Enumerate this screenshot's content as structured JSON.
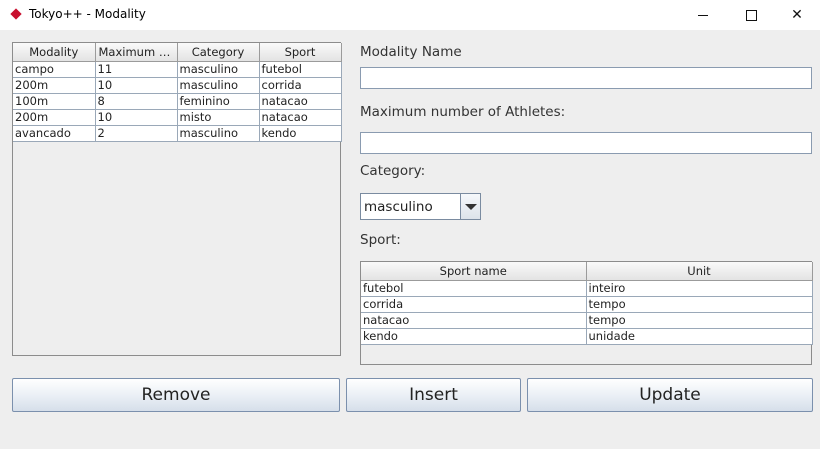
{
  "window": {
    "title": "Tokyo++ - Modality"
  },
  "modalities_table": {
    "columns": [
      "Modality",
      "Maximum at...",
      "Category",
      "Sport"
    ],
    "rows": [
      [
        "campo",
        "11",
        "masculino",
        "futebol"
      ],
      [
        "200m",
        "10",
        "masculino",
        "corrida"
      ],
      [
        "100m",
        "8",
        "feminino",
        "natacao"
      ],
      [
        "200m",
        "10",
        "misto",
        "natacao"
      ],
      [
        "avancado",
        "2",
        "masculino",
        "kendo"
      ]
    ]
  },
  "form": {
    "modality_name_label": "Modality Name",
    "modality_name_value": "",
    "max_athletes_label": "Maximum number of Athletes:",
    "max_athletes_value": "",
    "category_label": "Category:",
    "category_selected": "masculino",
    "sport_label": "Sport:"
  },
  "sport_table": {
    "columns": [
      "Sport name",
      "Unit"
    ],
    "rows": [
      [
        "futebol",
        "inteiro"
      ],
      [
        "corrida",
        "tempo"
      ],
      [
        "natacao",
        "tempo"
      ],
      [
        "kendo",
        "unidade"
      ]
    ]
  },
  "buttons": {
    "remove": "Remove",
    "insert": "Insert",
    "update": "Update"
  },
  "colors": {
    "app_icon": "#c8102e",
    "button_border": "#7b90ad"
  }
}
